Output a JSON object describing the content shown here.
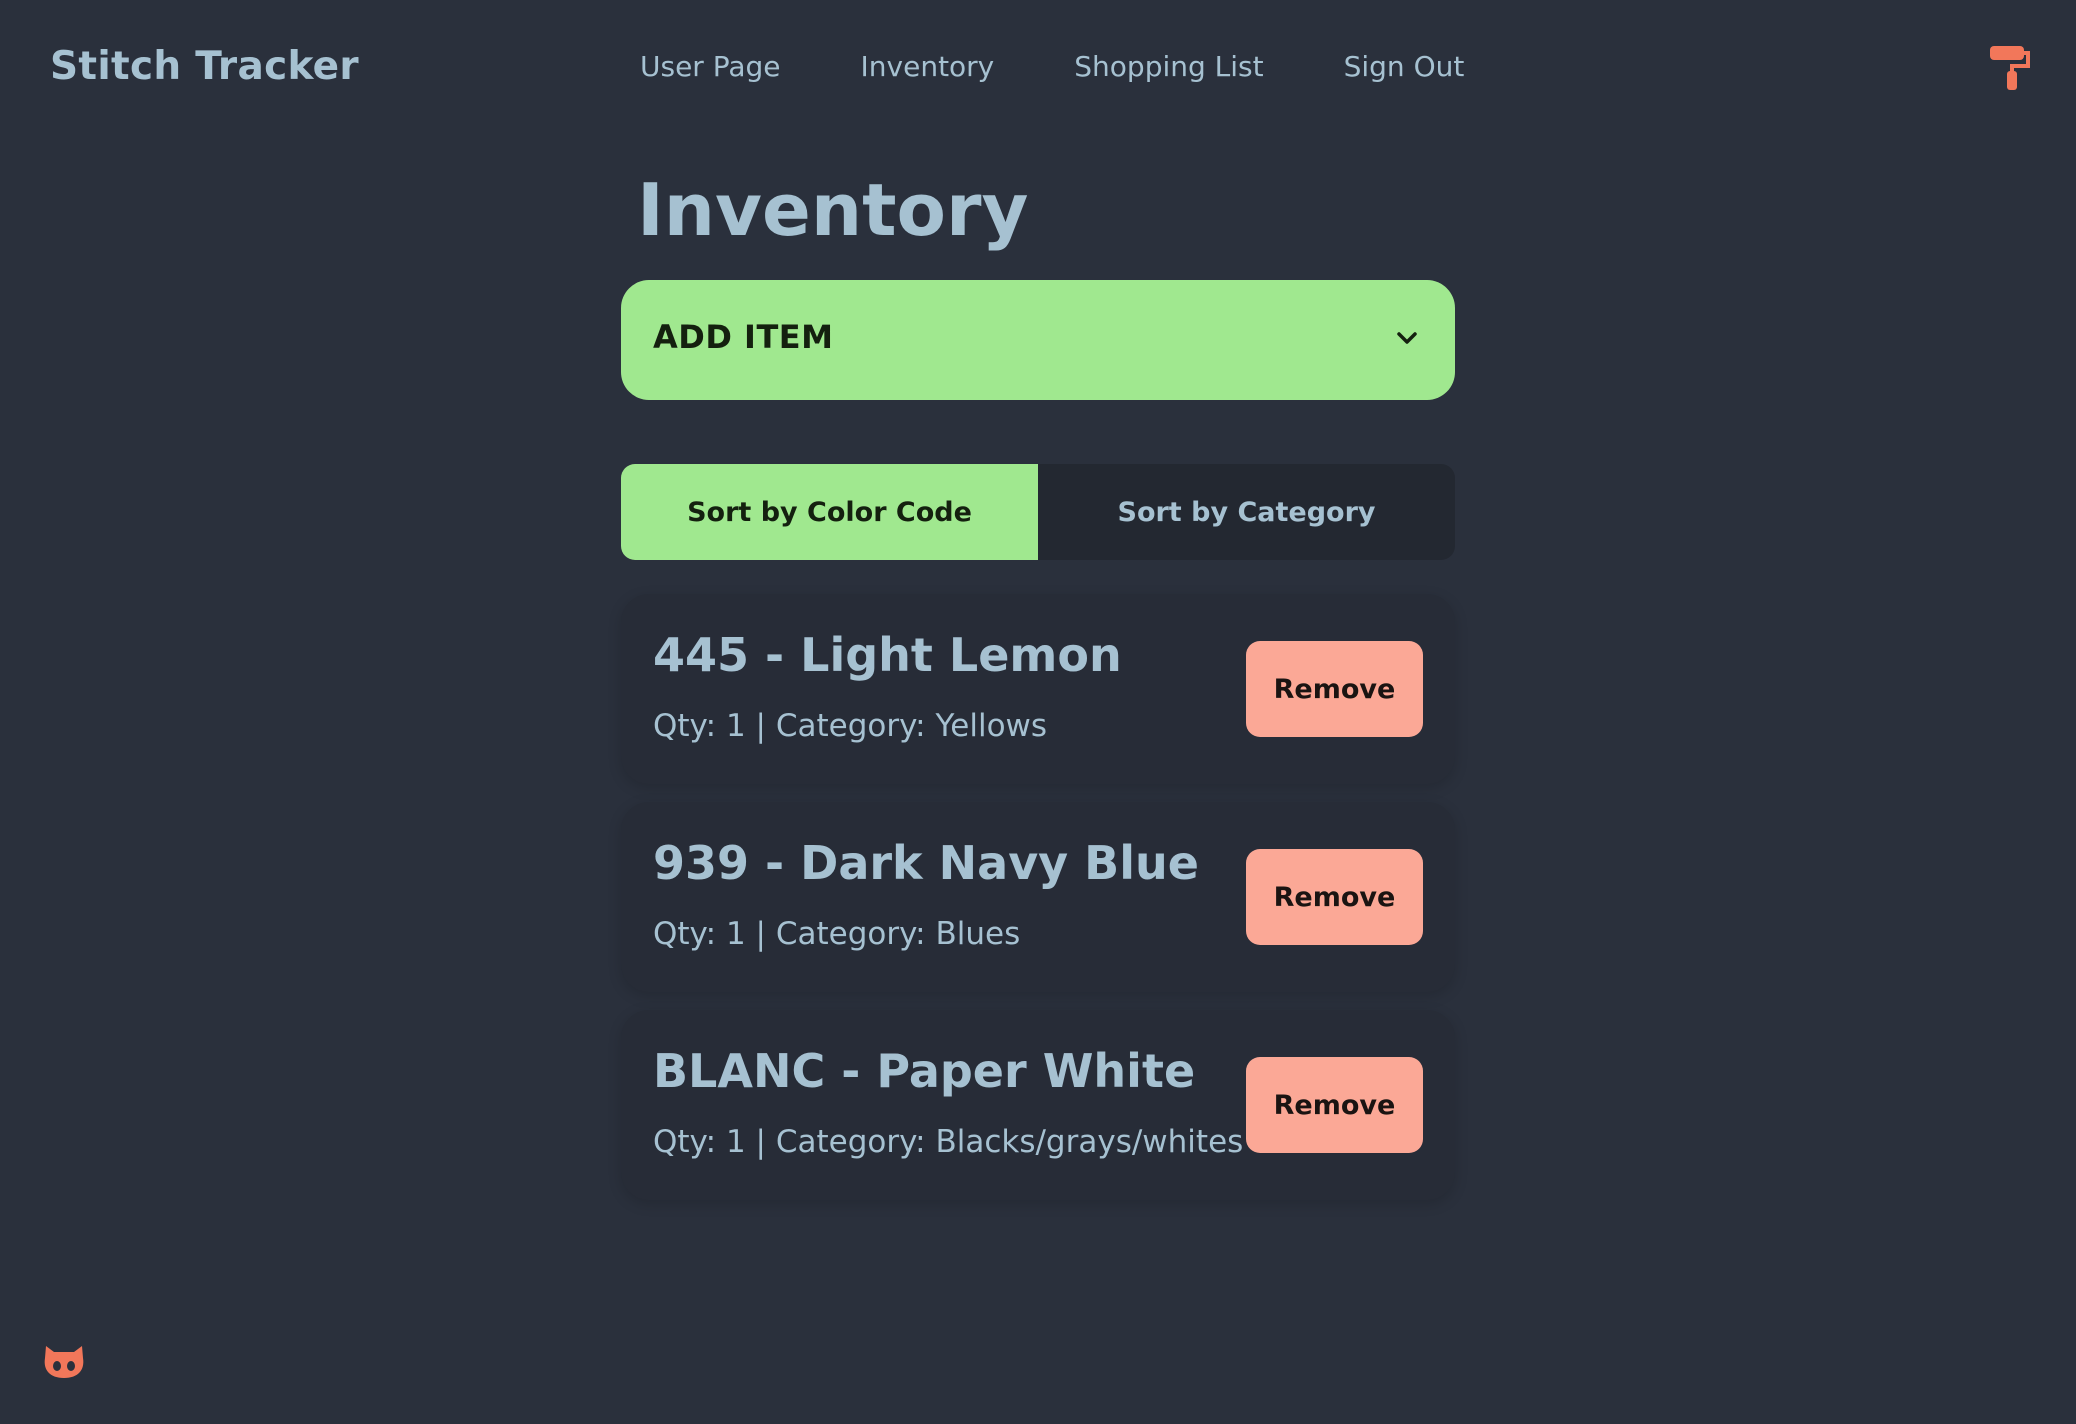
{
  "app": {
    "title": "Stitch Tracker"
  },
  "nav": {
    "items": [
      {
        "label": "User Page"
      },
      {
        "label": "Inventory"
      },
      {
        "label": "Shopping List"
      },
      {
        "label": "Sign Out"
      }
    ],
    "theme_icon": "paint-roller-icon"
  },
  "page": {
    "title": "Inventory"
  },
  "add_item": {
    "label": "ADD ITEM",
    "icon": "chevron-down-icon"
  },
  "sort": {
    "tabs": [
      {
        "label": "Sort by Color Code",
        "active": true
      },
      {
        "label": "Sort by Category",
        "active": false
      }
    ]
  },
  "inventory": {
    "items": [
      {
        "title": "445 - Light Lemon",
        "meta": "Qty: 1 | Category: Yellows",
        "action": "Remove"
      },
      {
        "title": "939 - Dark Navy Blue",
        "meta": "Qty: 1 | Category: Blues",
        "action": "Remove"
      },
      {
        "title": "BLANC - Paper White",
        "meta": "Qty: 1 | Category: Blacks/grays/whites",
        "action": "Remove"
      }
    ]
  },
  "footer": {
    "github_icon": "github-icon"
  },
  "colors": {
    "background": "#2a303c",
    "text": "#a6c1d1",
    "primary": "#a0e88f",
    "remove": "#fba896",
    "accent": "#f2775a"
  }
}
